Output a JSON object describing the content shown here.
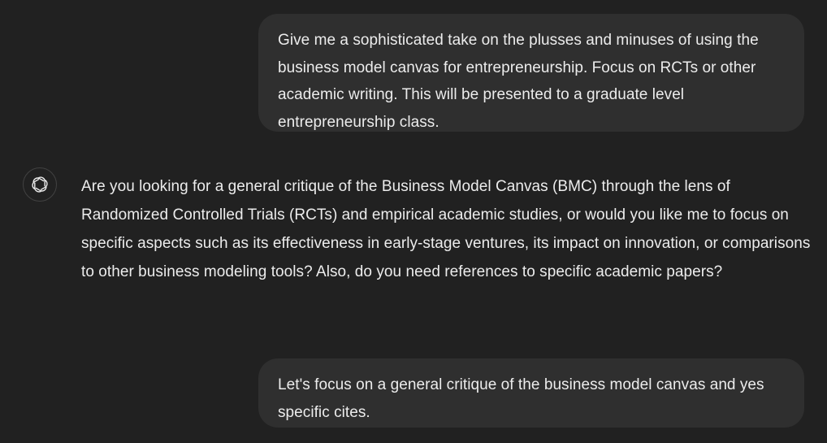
{
  "messages": {
    "user_1": "Give me a sophisticated take on the plusses and minuses of using the business model canvas for entrepreneurship. Focus on RCTs or other academic writing. This will be presented to a graduate level entrepreneurship class.",
    "assistant_1": "Are you looking for a general critique of the Business Model Canvas (BMC) through the lens of Randomized Controlled Trials (RCTs) and empirical academic studies, or would you like me to focus on specific aspects such as its effectiveness in early-stage ventures, its impact on innovation, or comparisons to other business modeling tools? Also, do you need references to specific academic papers?",
    "user_2": "Let's focus on a general critique of the business model canvas and yes specific cites."
  },
  "assistant": {
    "avatar_icon": "openai-logo-icon"
  },
  "colors": {
    "background": "#212121",
    "user_bubble": "#2f2f2f",
    "text": "#ececec",
    "avatar_border": "#424242"
  }
}
